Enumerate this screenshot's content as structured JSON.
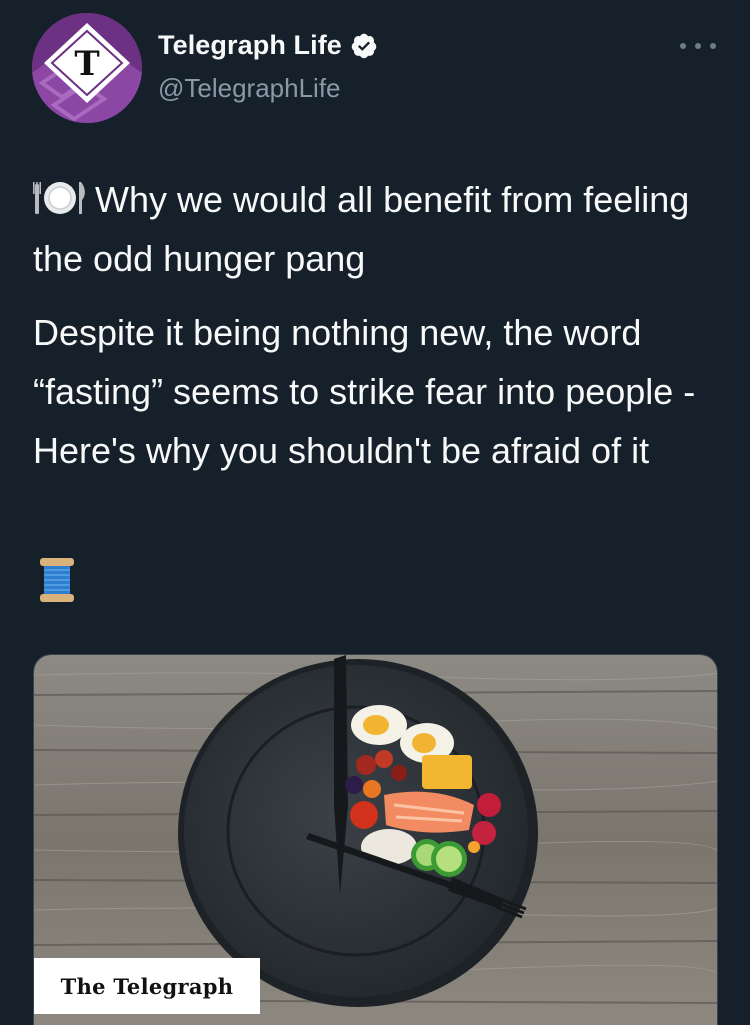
{
  "author": {
    "display_name": "Telegraph Life",
    "handle": "@TelegraphLife",
    "verified": true,
    "avatar_icon": "telegraph-t-logo-icon"
  },
  "more_icon": "more-options-icon",
  "tweet": {
    "headline_emoji": "plate-with-cutlery-icon",
    "headline": "Why we would all benefit from feeling the odd hunger pang",
    "body": "Despite it being nothing new, the word “fasting” seems to strike fear into people - Here's why you shouldn't be afraid of it",
    "thread_emoji": "spool-of-thread-icon"
  },
  "card": {
    "image_description_icon": "plate-with-food-clock-image",
    "publisher_badge": "The Telegraph"
  },
  "colors": {
    "background": "#15202b",
    "text_primary": "#f7f9f9",
    "text_secondary": "#8b98a5",
    "verified": "#f7f9f9",
    "avatar": "#7b3a8f"
  }
}
